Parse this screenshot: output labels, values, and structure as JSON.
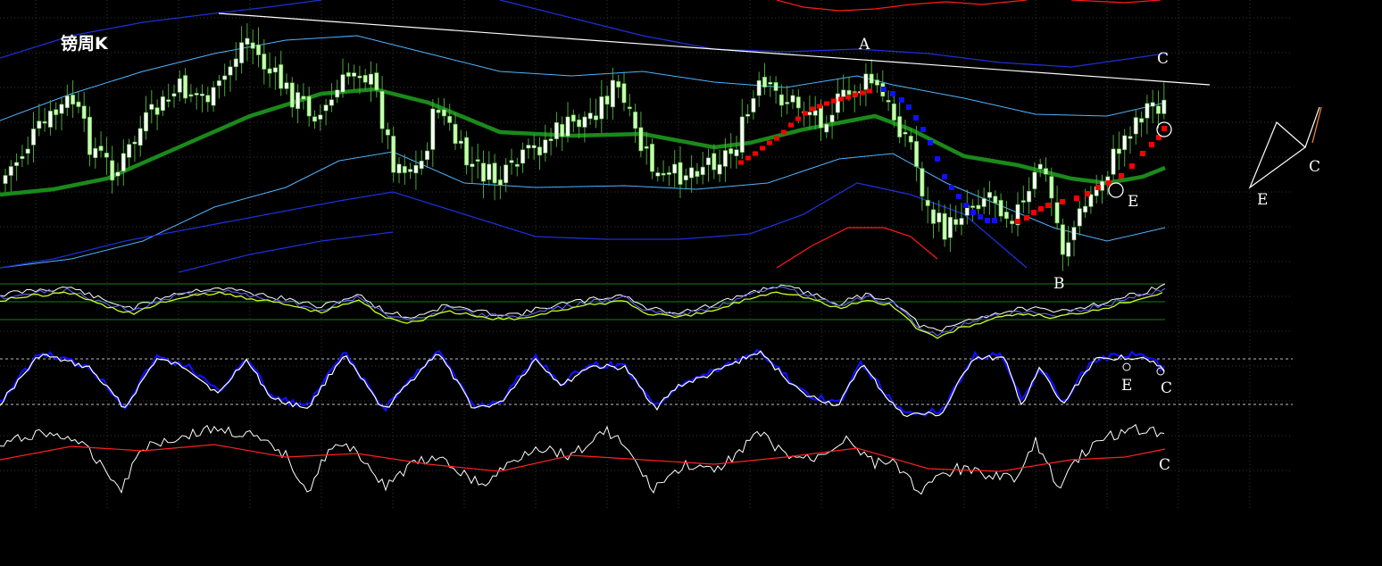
{
  "title": "镑周K",
  "labels": {
    "a": "A",
    "b": "B",
    "c_top": "C",
    "e_main": "E",
    "e_stoch": "E",
    "c_stoch": "C",
    "c_bottom": "C",
    "legend_c": "C",
    "legend_e": "E"
  },
  "colors": {
    "background": "#000000",
    "candle_up_body": "#ffffff",
    "candle_wick": "#4aa83a",
    "candle_down_body": "#c8ffb0",
    "ma_thick": "#1a8a1a",
    "band_inner": "#4fb3ff",
    "band_outer": "#1c2fd8",
    "band_extreme": "#ff1a1a",
    "trendline": "#ffffff",
    "sar_up": "#ff0000",
    "sar_down": "#1010ff",
    "stoch_k": "#1010ff",
    "stoch_d": "#ffffff",
    "osc_line": "#ffffff",
    "osc_signal": "#ff2020",
    "grid": "#333333"
  },
  "chart_data": [
    {
      "type": "candlestick",
      "panel": "price",
      "series": [
        {
          "name": "",
          "kind": "ohlc"
        },
        {
          "name": "",
          "kind": "moving_average"
        },
        {
          "name": "",
          "kind": "envelope_bands"
        },
        {
          "name": "",
          "kind": "parabolic_sar"
        }
      ],
      "annotations": [
        "A",
        "B",
        "C",
        "E"
      ]
    },
    {
      "type": "line",
      "panel": "oscillator_1",
      "series": [
        {
          "name": ""
        },
        {
          "name": ""
        },
        {
          "name": ""
        }
      ]
    },
    {
      "type": "line",
      "panel": "stochastic",
      "series": [
        {
          "name": ""
        },
        {
          "name": ""
        }
      ],
      "annotations": [
        "E",
        "C"
      ]
    },
    {
      "type": "line",
      "panel": "oscillator_2",
      "series": [
        {
          "name": ""
        },
        {
          "name": ""
        }
      ],
      "annotations": [
        "C"
      ]
    }
  ]
}
